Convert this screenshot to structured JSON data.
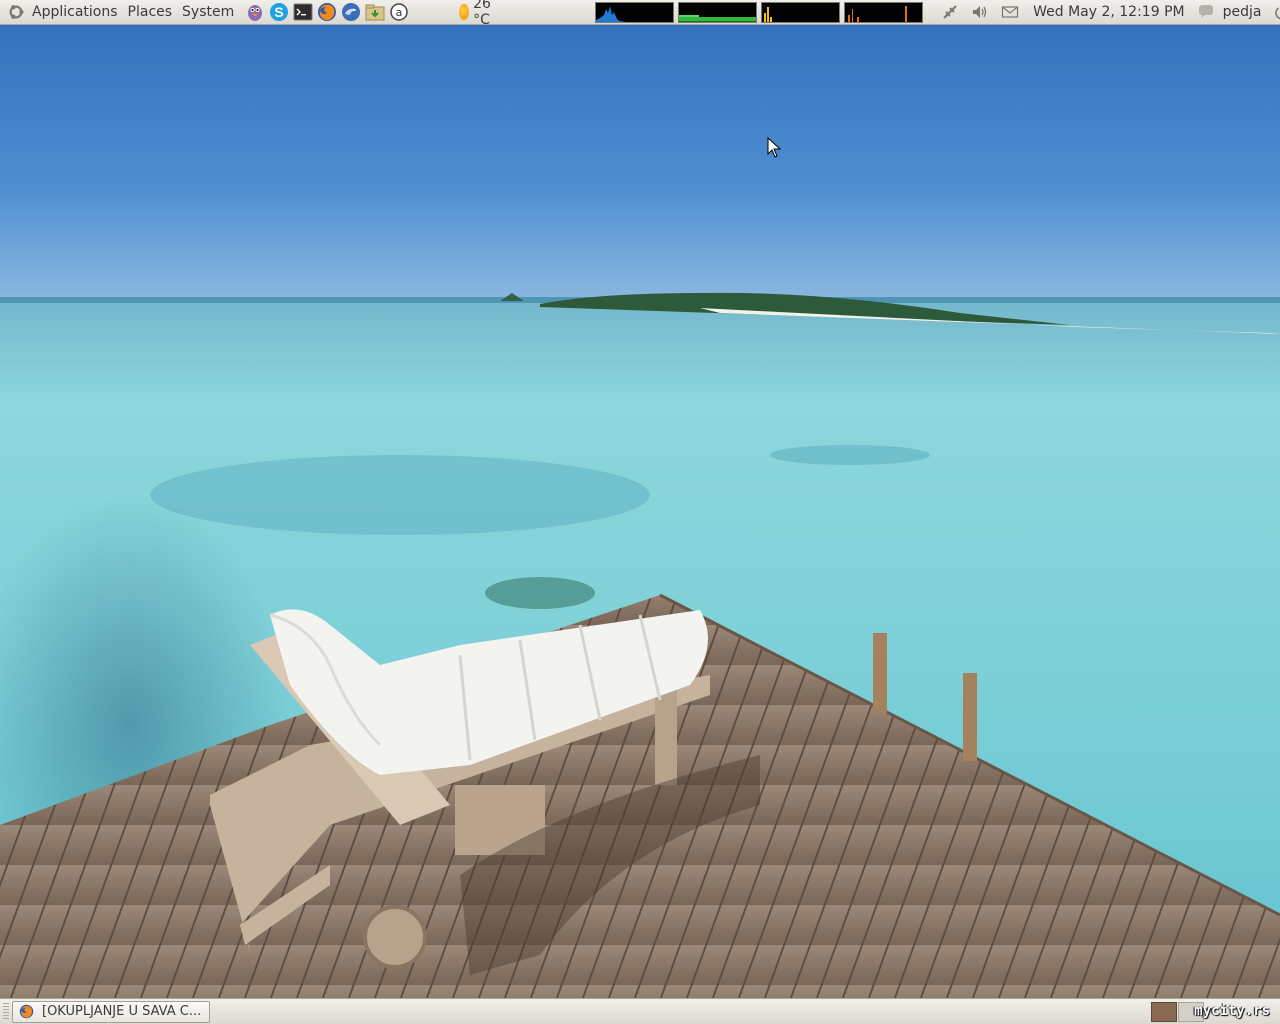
{
  "top_panel": {
    "menus": [
      "Applications",
      "Places",
      "System"
    ],
    "launchers": [
      "pidgin-icon",
      "skype-icon",
      "terminal-icon",
      "firefox-icon",
      "thunderbird-icon",
      "download-folder-icon",
      "at-sign-icon"
    ],
    "weather": {
      "temperature": "26 °C",
      "icon": "sun-icon"
    },
    "system_monitors": [
      "cpu-monitor",
      "memory-monitor",
      "network-monitor",
      "load-monitor"
    ],
    "tray_icons": [
      "network-disconnected-icon",
      "volume-icon",
      "mail-icon"
    ],
    "clock": "Wed May  2, 12:19 PM",
    "user": "pedja",
    "user_status_icon": "chat-status-icon",
    "power_icon": "power-icon"
  },
  "bottom_panel": {
    "task": {
      "label": "[OKUPLJANJE U SAVA C...",
      "icon": "firefox-icon"
    },
    "workspaces": 2,
    "watermark": "mycity.rs"
  },
  "colors": {
    "panel_top": "#f1efeb",
    "panel_bottom": "#dcd9d2",
    "sky": "#3d7cc4",
    "water": "#7fd4dc",
    "deck": "#8c7766"
  }
}
